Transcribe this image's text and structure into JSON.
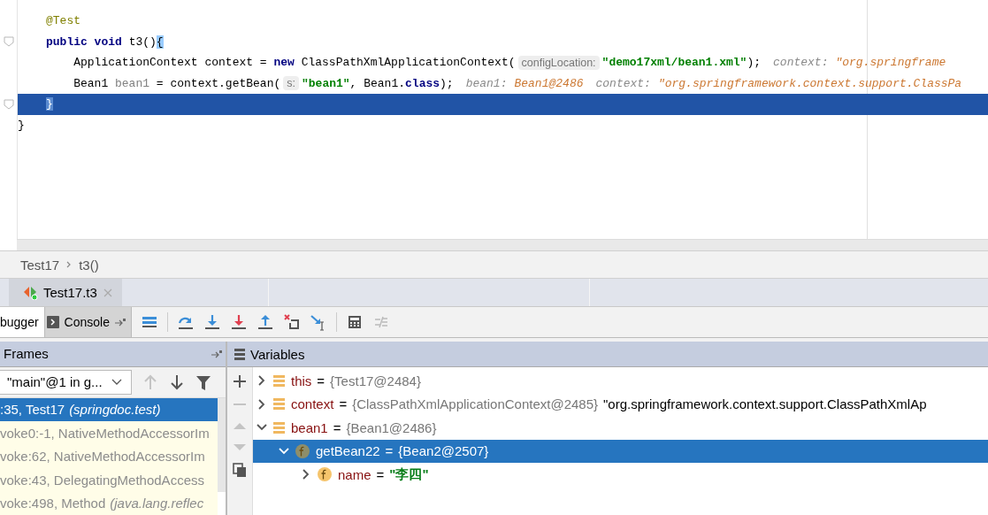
{
  "editor": {
    "lines": [
      {
        "current": false,
        "tokens": [
          {
            "kind": "ann",
            "text": "@Test"
          }
        ]
      },
      {
        "current": false,
        "tokens": [
          {
            "kind": "kw",
            "text": "public void"
          },
          {
            "kind": "plain",
            "text": " t3()"
          },
          {
            "kind": "match",
            "text": "{"
          }
        ]
      },
      {
        "current": false,
        "tokens": [
          {
            "kind": "plain",
            "text": "    ApplicationContext context = "
          },
          {
            "kind": "kw",
            "text": "new"
          },
          {
            "kind": "plain",
            "text": " ClassPathXmlApplicationContext("
          },
          {
            "kind": "inlay",
            "text": "configLocation:"
          },
          {
            "kind": "str",
            "text": "\"demo17xml/bean1.xml\""
          },
          {
            "kind": "plain",
            "text": ");"
          },
          {
            "kind": "dbgname",
            "text": "context:"
          },
          {
            "kind": "dbgval",
            "text": "\"org.springframe"
          }
        ]
      },
      {
        "current": false,
        "tokens": [
          {
            "kind": "plain",
            "text": "    Bean1 "
          },
          {
            "kind": "unused",
            "text": "bean1"
          },
          {
            "kind": "plain",
            "text": " = context.getBean("
          },
          {
            "kind": "inlay",
            "text": "s:"
          },
          {
            "kind": "str",
            "text": "\"bean1\""
          },
          {
            "kind": "plain",
            "text": ", Bean1."
          },
          {
            "kind": "kw",
            "text": "class"
          },
          {
            "kind": "plain",
            "text": ");"
          },
          {
            "kind": "dbgname",
            "text": "bean1:"
          },
          {
            "kind": "dbgval",
            "text": "Bean1@2486"
          },
          {
            "kind": "dbgname",
            "text": "context:"
          },
          {
            "kind": "dbgval",
            "text": "\"org.springframework.context.support.ClassPa"
          }
        ]
      },
      {
        "current": true,
        "tokens": [
          {
            "kind": "match",
            "text": "}"
          }
        ]
      },
      {
        "current": false,
        "tokens": [
          {
            "kind": "brace",
            "text": "}"
          }
        ]
      }
    ]
  },
  "breadcrumb": [
    "Test17",
    "t3()"
  ],
  "session_tab": {
    "label": "Test17.t3"
  },
  "debugger_tabs": [
    {
      "label": "bugger",
      "selected": true
    },
    {
      "label": "Console",
      "selected": false
    }
  ],
  "frames": {
    "title": "Frames",
    "thread": "\"main\"@1 in g...",
    "items": [
      {
        "text": ":35, Test17",
        "package": "(springdoc.test)",
        "selected": true,
        "library": false
      },
      {
        "text": "voke0:-1, NativeMethodAccessorIm",
        "selected": false,
        "library": true
      },
      {
        "text": "voke:62, NativeMethodAccessorIm",
        "selected": false,
        "library": true
      },
      {
        "text": "voke:43, DelegatingMethodAccess",
        "selected": false,
        "library": true
      },
      {
        "text": "voke:498, Method",
        "package": "(java.lang.reflec",
        "selected": false,
        "library": true
      }
    ]
  },
  "variables": {
    "title": "Variables",
    "items": [
      {
        "kind": "local",
        "name": "this",
        "equals": "=",
        "value": "{Test17@2484}",
        "expanded": false,
        "selected": false
      },
      {
        "kind": "local",
        "name": "context",
        "equals": "=",
        "value": "{ClassPathXmlApplicationContext@2485}",
        "extra": "\"org.springframework.context.support.ClassPathXmlAp",
        "expanded": false,
        "selected": false
      },
      {
        "kind": "local",
        "name": "bean1",
        "equals": "=",
        "value": "{Bean1@2486}",
        "expanded": true,
        "selected": false,
        "children": [
          {
            "kind": "field",
            "name": "getBean22",
            "equals": "=",
            "value": "{Bean2@2507}",
            "expanded": true,
            "selected": true,
            "children": [
              {
                "kind": "stringfield",
                "name": "name",
                "equals": "=",
                "value": "\"李四\"",
                "expanded": false,
                "selected": false
              }
            ]
          }
        ]
      }
    ]
  }
}
